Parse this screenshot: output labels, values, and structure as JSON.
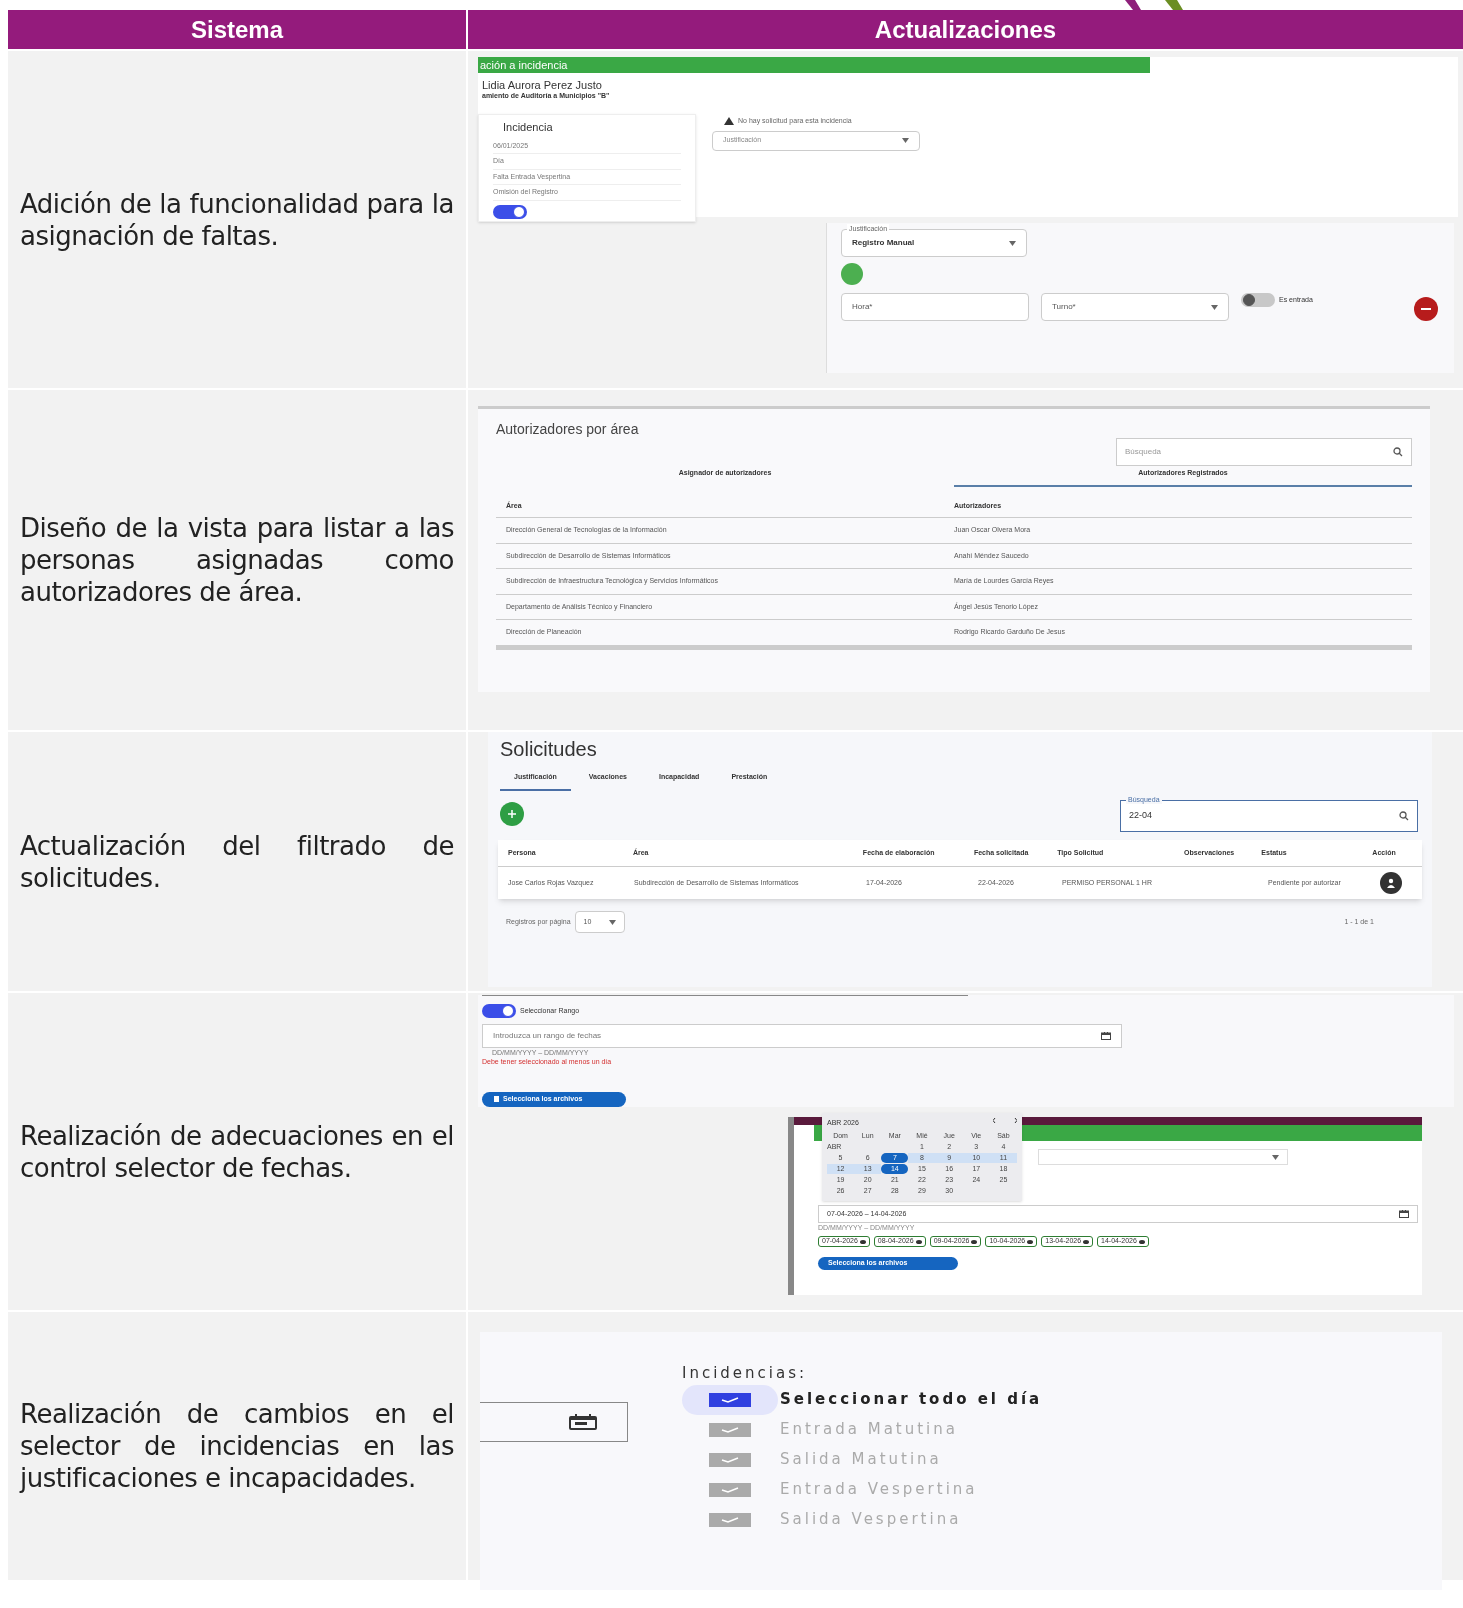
{
  "header": {
    "columns": [
      "Sistema",
      "Actualizaciones"
    ]
  },
  "rows": [
    {
      "description": "Adición de la funcionalidad para la asignación de faltas.",
      "screenshot": {
        "kind": "incidence",
        "banner": "ación a incidencia",
        "person": "Lidia Aurora Perez Justo",
        "unit": "amiento de Auditoría a Municipios \"B\"",
        "card_title": "Incidencia",
        "card_items": [
          "06/01/2025",
          "Día",
          "Falta Entrada Vespertina",
          "Omisión del Registro"
        ],
        "card_toggle": {
          "on": true
        },
        "notice": "No hay solicitud para esta incidencia",
        "select": "Justificación",
        "form": {
          "select_label": "Justificación",
          "select_value": "Registro Manual",
          "hour": "Hora*",
          "shift": "Turno*",
          "entry_toggle": {
            "on": false,
            "label": "Es entrada"
          }
        }
      }
    },
    {
      "description": "Diseño de la vista para listar a las personas asignadas como autorizadores de área.",
      "screenshot": {
        "kind": "authorizers",
        "title": "Autorizadores por área",
        "search": {
          "placeholder": "Búsqueda"
        },
        "tabs": [
          {
            "label": "Asignador de autorizadores",
            "selected": false
          },
          {
            "label": "Autorizadores Registrados",
            "selected": true
          }
        ],
        "columns": [
          "Área",
          "Autorizadores"
        ],
        "rows": [
          [
            "Dirección General de Tecnologías de la Información",
            "Juan Oscar Olvera Mora"
          ],
          [
            "Subdirección de Desarrollo de Sistemas Informáticos",
            "Anahí Méndez Saucedo"
          ],
          [
            "Subdirección de Infraestructura Tecnológica y Servicios Informáticos",
            "María de Lourdes García Reyes"
          ],
          [
            "Departamento de Análisis Técnico y Financiero",
            "Ángel Jesús Tenorio López"
          ],
          [
            "Dirección de Planeación",
            "Rodrigo Ricardo Garduño De Jesus"
          ]
        ]
      }
    },
    {
      "description": "Actualización del filtrado de solicitudes.",
      "screenshot": {
        "kind": "requests",
        "title": "Solicitudes",
        "tabs": [
          {
            "label": "Justificación",
            "selected": true
          },
          {
            "label": "Vacaciones",
            "selected": false
          },
          {
            "label": "Incapacidad",
            "selected": false
          },
          {
            "label": "Prestación",
            "selected": false
          }
        ],
        "search": {
          "label": "Búsqueda",
          "value": "22-04"
        },
        "columns": [
          "Persona",
          "Área",
          "Fecha de elaboración",
          "Fecha solicitada",
          "Tipo Solicitud",
          "Observaciones",
          "Estatus",
          "Acción"
        ],
        "rows": [
          [
            "Jose Carlos Rojas Vazquez",
            "Subdirección de Desarrollo de Sistemas Informáticos",
            "17-04-2026",
            "22-04-2026",
            "PERMISO PERSONAL 1 HR",
            "",
            "Pendiente por autorizar"
          ]
        ],
        "page_size_label": "Registros por página",
        "page_size": "10",
        "range": "1 - 1 de 1"
      }
    },
    {
      "description": "Realización de adecuaciones en el control selector de fechas.",
      "screenshot": {
        "kind": "datepicker",
        "range_toggle": {
          "on": true,
          "label": "Seleccionar Rango"
        },
        "date_field": {
          "placeholder": "Introduzca un rango de fechas"
        },
        "hint": "DD/MM/YYYY – DD/MM/YYYY",
        "error": "Debe tener seleccionado al menos un día",
        "upload": "Selecciona los archivos",
        "calendar": {
          "month": "ABR 2026",
          "weekdays": [
            "Dom",
            "Lun",
            "Mar",
            "Mié",
            "Jue",
            "Vie",
            "Sáb"
          ],
          "first_label": "ABR",
          "weeks": [
            [
              {
                "label": "1",
                "selected": false,
                "in_range": false
              },
              {
                "label": "2",
                "selected": false,
                "in_range": false
              },
              {
                "label": "3",
                "selected": false,
                "in_range": false
              },
              {
                "label": "4",
                "selected": false,
                "in_range": false
              }
            ],
            [
              {
                "label": "5",
                "selected": false,
                "in_range": false
              },
              {
                "label": "6",
                "selected": false,
                "in_range": false
              },
              {
                "label": "7",
                "selected": true,
                "in_range": false
              },
              {
                "label": "8",
                "selected": false,
                "in_range": true
              },
              {
                "label": "9",
                "selected": false,
                "in_range": true
              },
              {
                "label": "10",
                "selected": false,
                "in_range": true
              },
              {
                "label": "11",
                "selected": false,
                "in_range": true
              }
            ],
            [
              {
                "label": "12",
                "selected": false,
                "in_range": true
              },
              {
                "label": "13",
                "selected": false,
                "in_range": true
              },
              {
                "label": "14",
                "selected": true,
                "in_range": false
              },
              {
                "label": "15",
                "selected": false,
                "in_range": false
              },
              {
                "label": "16",
                "selected": false,
                "in_range": false
              },
              {
                "label": "17",
                "selected": false,
                "in_range": false
              },
              {
                "label": "18",
                "selected": false,
                "in_range": false
              }
            ],
            [
              {
                "label": "19",
                "selected": false,
                "in_range": false
              },
              {
                "label": "20",
                "selected": false,
                "in_range": false
              },
              {
                "label": "21",
                "selected": false,
                "in_range": false
              },
              {
                "label": "22",
                "selected": false,
                "in_range": false
              },
              {
                "label": "23",
                "selected": false,
                "in_range": false
              },
              {
                "label": "24",
                "selected": false,
                "in_range": false
              },
              {
                "label": "25",
                "selected": false,
                "in_range": false
              }
            ],
            [
              {
                "label": "26",
                "selected": false,
                "in_range": false
              },
              {
                "label": "27",
                "selected": false,
                "in_range": false
              },
              {
                "label": "28",
                "selected": false,
                "in_range": false
              },
              {
                "label": "29",
                "selected": false,
                "in_range": false
              },
              {
                "label": "30",
                "selected": false,
                "in_range": false
              }
            ]
          ]
        },
        "range_value": "07-04-2026 – 14-04-2026",
        "range_hint": "DD/MM/YYYY – DD/MM/YYYY",
        "chips": [
          "07-04-2026",
          "08-04-2026",
          "09-04-2026",
          "10-04-2026",
          "13-04-2026",
          "14-04-2026"
        ],
        "upload2": "Selecciona los archivos"
      }
    },
    {
      "description": "Realización de cambios en el selector de incidencias en las justificaciones e incapacidades.",
      "screenshot": {
        "kind": "incidences",
        "title": "Incidencias:",
        "options": [
          {
            "label": "Seleccionar todo el día",
            "checked": true,
            "disabled": false
          },
          {
            "label": "Entrada Matutina",
            "checked": true,
            "disabled": true
          },
          {
            "label": "Salida Matutina",
            "checked": true,
            "disabled": true
          },
          {
            "label": "Entrada Vespertina",
            "checked": true,
            "disabled": true
          },
          {
            "label": "Salida Vespertina",
            "checked": true,
            "disabled": true
          }
        ]
      }
    }
  ]
}
